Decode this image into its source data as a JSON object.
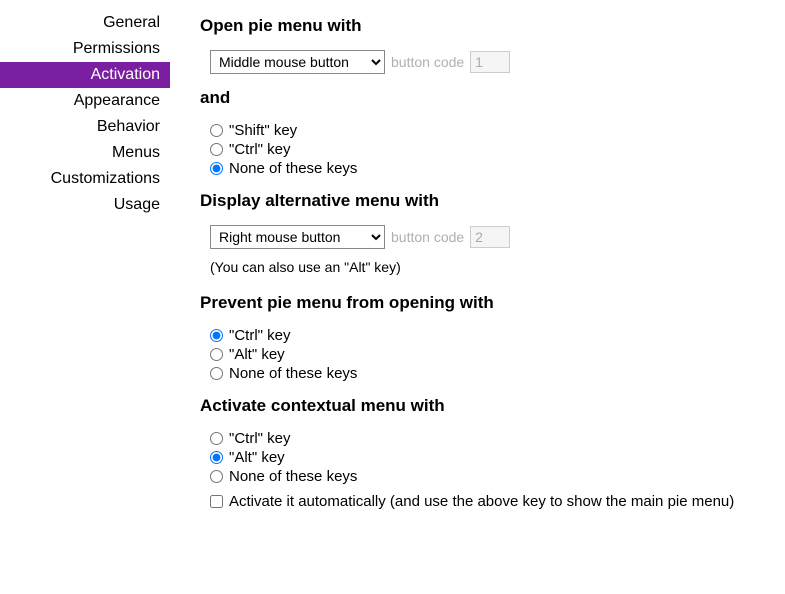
{
  "sidebar": {
    "items": [
      {
        "label": "General",
        "active": false
      },
      {
        "label": "Permissions",
        "active": false
      },
      {
        "label": "Activation",
        "active": true
      },
      {
        "label": "Appearance",
        "active": false
      },
      {
        "label": "Behavior",
        "active": false
      },
      {
        "label": "Menus",
        "active": false
      },
      {
        "label": "Customizations",
        "active": false
      },
      {
        "label": "Usage",
        "active": false
      }
    ]
  },
  "sections": {
    "open_pie": {
      "heading": "Open pie menu with",
      "select_value": "Middle mouse button",
      "button_code_label": "button code",
      "button_code_value": "1",
      "and_heading": "and",
      "radios": [
        {
          "label": "\"Shift\" key",
          "checked": false
        },
        {
          "label": "\"Ctrl\" key",
          "checked": false
        },
        {
          "label": "None of these keys",
          "checked": true
        }
      ]
    },
    "alt_menu": {
      "heading": "Display alternative menu with",
      "select_value": "Right mouse button",
      "button_code_label": "button code",
      "button_code_value": "2",
      "note": "(You can also use an \"Alt\" key)"
    },
    "prevent": {
      "heading": "Prevent pie menu from opening with",
      "radios": [
        {
          "label": "\"Ctrl\" key",
          "checked": true
        },
        {
          "label": "\"Alt\" key",
          "checked": false
        },
        {
          "label": "None of these keys",
          "checked": false
        }
      ]
    },
    "contextual": {
      "heading": "Activate contextual menu with",
      "radios": [
        {
          "label": "\"Ctrl\" key",
          "checked": false
        },
        {
          "label": "\"Alt\" key",
          "checked": true
        },
        {
          "label": "None of these keys",
          "checked": false
        }
      ],
      "auto_checkbox": {
        "label": "Activate it automatically (and use the above key to show the main pie menu)",
        "checked": false
      }
    }
  }
}
